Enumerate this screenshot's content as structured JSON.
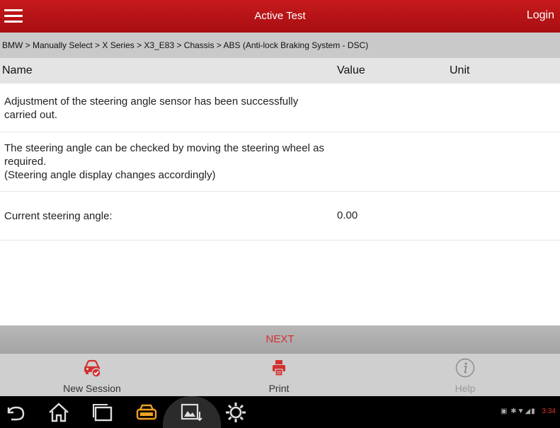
{
  "header": {
    "title": "Active Test",
    "login_label": "Login"
  },
  "breadcrumb": "BMW > Manually Select > X Series > X3_E83 > Chassis > ABS (Anti-lock Braking System - DSC)",
  "table": {
    "columns": {
      "name": "Name",
      "value": "Value",
      "unit": "Unit"
    },
    "rows": [
      {
        "name": "Adjustment of the steering angle sensor has been successfully carried out.",
        "value": "",
        "unit": ""
      },
      {
        "name": "The steering angle can be checked by moving the steering wheel as required.\n(Steering angle display changes accordingly)",
        "value": "",
        "unit": ""
      },
      {
        "name": "Current steering angle:",
        "value": "0.00",
        "unit": ""
      }
    ]
  },
  "next_label": "NEXT",
  "actions": {
    "new_session": {
      "label": "New Session",
      "icon": "car-check-icon"
    },
    "print": {
      "label": "Print",
      "icon": "printer-icon"
    },
    "help": {
      "label": "Help",
      "icon": "info-icon"
    }
  },
  "status_bar": {
    "time": "3:34",
    "icons": [
      "screenshot-icon",
      "bluetooth-icon",
      "wifi-icon",
      "signal-icon",
      "battery-icon"
    ]
  },
  "colors": {
    "header_red": "#b91417",
    "accent_red": "#d23030",
    "orange": "#f0a020"
  }
}
